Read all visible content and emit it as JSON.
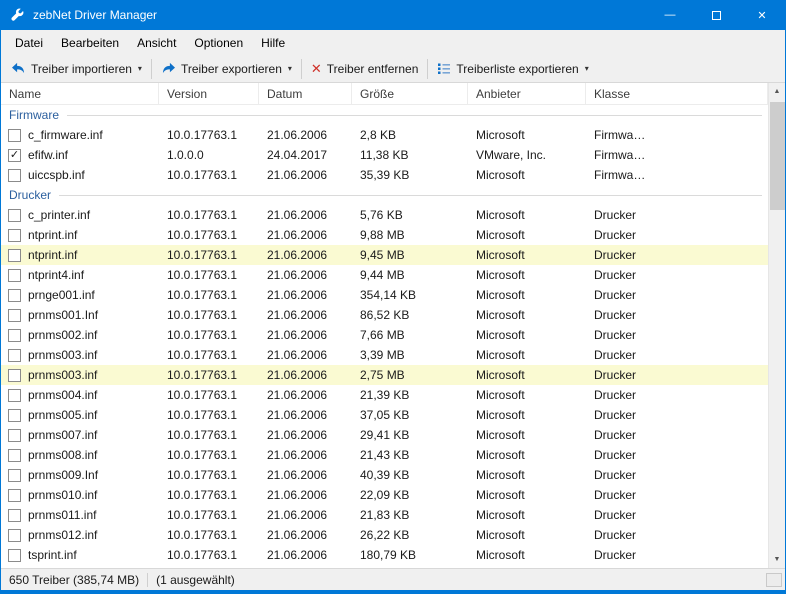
{
  "window": {
    "title": "zebNet Driver Manager"
  },
  "icons": {
    "dropdown": "▾",
    "remove_x": "✕",
    "check": "✓",
    "minimize": "—",
    "close": "✕",
    "scroll_up": "▲",
    "scroll_down": "▼"
  },
  "menubar": {
    "items": [
      "Datei",
      "Bearbeiten",
      "Ansicht",
      "Optionen",
      "Hilfe"
    ]
  },
  "toolbar": {
    "import_label": "Treiber importieren",
    "export_label": "Treiber exportieren",
    "remove_label": "Treiber entfernen",
    "export_list_label": "Treiberliste exportieren"
  },
  "table": {
    "columns": [
      "Name",
      "Version",
      "Datum",
      "Größe",
      "Anbieter",
      "Klasse"
    ],
    "groups": [
      {
        "id": "firmware",
        "label": "Firmware",
        "rows": [
          {
            "name": "c_firmware.inf",
            "version": "10.0.17763.1",
            "date": "21.06.2006",
            "size": "2,8 KB",
            "provider": "Microsoft",
            "class": "Firmwa…",
            "checked": false,
            "highlight": false
          },
          {
            "name": "efifw.inf",
            "version": "1.0.0.0",
            "date": "24.04.2017",
            "size": "11,38 KB",
            "provider": "VMware, Inc.",
            "class": "Firmwa…",
            "checked": true,
            "highlight": false
          },
          {
            "name": "uiccspb.inf",
            "version": "10.0.17763.1",
            "date": "21.06.2006",
            "size": "35,39 KB",
            "provider": "Microsoft",
            "class": "Firmwa…",
            "checked": false,
            "highlight": false
          }
        ]
      },
      {
        "id": "drucker",
        "label": "Drucker",
        "rows": [
          {
            "name": "c_printer.inf",
            "version": "10.0.17763.1",
            "date": "21.06.2006",
            "size": "5,76 KB",
            "provider": "Microsoft",
            "class": "Drucker",
            "checked": false,
            "highlight": false
          },
          {
            "name": "ntprint.inf",
            "version": "10.0.17763.1",
            "date": "21.06.2006",
            "size": "9,88 MB",
            "provider": "Microsoft",
            "class": "Drucker",
            "checked": false,
            "highlight": false
          },
          {
            "name": "ntprint.inf",
            "version": "10.0.17763.1",
            "date": "21.06.2006",
            "size": "9,45 MB",
            "provider": "Microsoft",
            "class": "Drucker",
            "checked": false,
            "highlight": true
          },
          {
            "name": "ntprint4.inf",
            "version": "10.0.17763.1",
            "date": "21.06.2006",
            "size": "9,44 MB",
            "provider": "Microsoft",
            "class": "Drucker",
            "checked": false,
            "highlight": false
          },
          {
            "name": "prnge001.inf",
            "version": "10.0.17763.1",
            "date": "21.06.2006",
            "size": "354,14 KB",
            "provider": "Microsoft",
            "class": "Drucker",
            "checked": false,
            "highlight": false
          },
          {
            "name": "prnms001.Inf",
            "version": "10.0.17763.1",
            "date": "21.06.2006",
            "size": "86,52 KB",
            "provider": "Microsoft",
            "class": "Drucker",
            "checked": false,
            "highlight": false
          },
          {
            "name": "prnms002.inf",
            "version": "10.0.17763.1",
            "date": "21.06.2006",
            "size": "7,66 MB",
            "provider": "Microsoft",
            "class": "Drucker",
            "checked": false,
            "highlight": false
          },
          {
            "name": "prnms003.inf",
            "version": "10.0.17763.1",
            "date": "21.06.2006",
            "size": "3,39 MB",
            "provider": "Microsoft",
            "class": "Drucker",
            "checked": false,
            "highlight": false
          },
          {
            "name": "prnms003.inf",
            "version": "10.0.17763.1",
            "date": "21.06.2006",
            "size": "2,75 MB",
            "provider": "Microsoft",
            "class": "Drucker",
            "checked": false,
            "highlight": true
          },
          {
            "name": "prnms004.inf",
            "version": "10.0.17763.1",
            "date": "21.06.2006",
            "size": "21,39 KB",
            "provider": "Microsoft",
            "class": "Drucker",
            "checked": false,
            "highlight": false
          },
          {
            "name": "prnms005.inf",
            "version": "10.0.17763.1",
            "date": "21.06.2006",
            "size": "37,05 KB",
            "provider": "Microsoft",
            "class": "Drucker",
            "checked": false,
            "highlight": false
          },
          {
            "name": "prnms007.inf",
            "version": "10.0.17763.1",
            "date": "21.06.2006",
            "size": "29,41 KB",
            "provider": "Microsoft",
            "class": "Drucker",
            "checked": false,
            "highlight": false
          },
          {
            "name": "prnms008.inf",
            "version": "10.0.17763.1",
            "date": "21.06.2006",
            "size": "21,43 KB",
            "provider": "Microsoft",
            "class": "Drucker",
            "checked": false,
            "highlight": false
          },
          {
            "name": "prnms009.Inf",
            "version": "10.0.17763.1",
            "date": "21.06.2006",
            "size": "40,39 KB",
            "provider": "Microsoft",
            "class": "Drucker",
            "checked": false,
            "highlight": false
          },
          {
            "name": "prnms010.inf",
            "version": "10.0.17763.1",
            "date": "21.06.2006",
            "size": "22,09 KB",
            "provider": "Microsoft",
            "class": "Drucker",
            "checked": false,
            "highlight": false
          },
          {
            "name": "prnms011.inf",
            "version": "10.0.17763.1",
            "date": "21.06.2006",
            "size": "21,83 KB",
            "provider": "Microsoft",
            "class": "Drucker",
            "checked": false,
            "highlight": false
          },
          {
            "name": "prnms012.inf",
            "version": "10.0.17763.1",
            "date": "21.06.2006",
            "size": "26,22 KB",
            "provider": "Microsoft",
            "class": "Drucker",
            "checked": false,
            "highlight": false
          },
          {
            "name": "tsprint.inf",
            "version": "10.0.17763.1",
            "date": "21.06.2006",
            "size": "180,79 KB",
            "provider": "Microsoft",
            "class": "Drucker",
            "checked": false,
            "highlight": false
          }
        ]
      }
    ]
  },
  "statusbar": {
    "count_text": "650 Treiber (385,74 MB)",
    "selection_text": "(1 ausgewählt)"
  }
}
